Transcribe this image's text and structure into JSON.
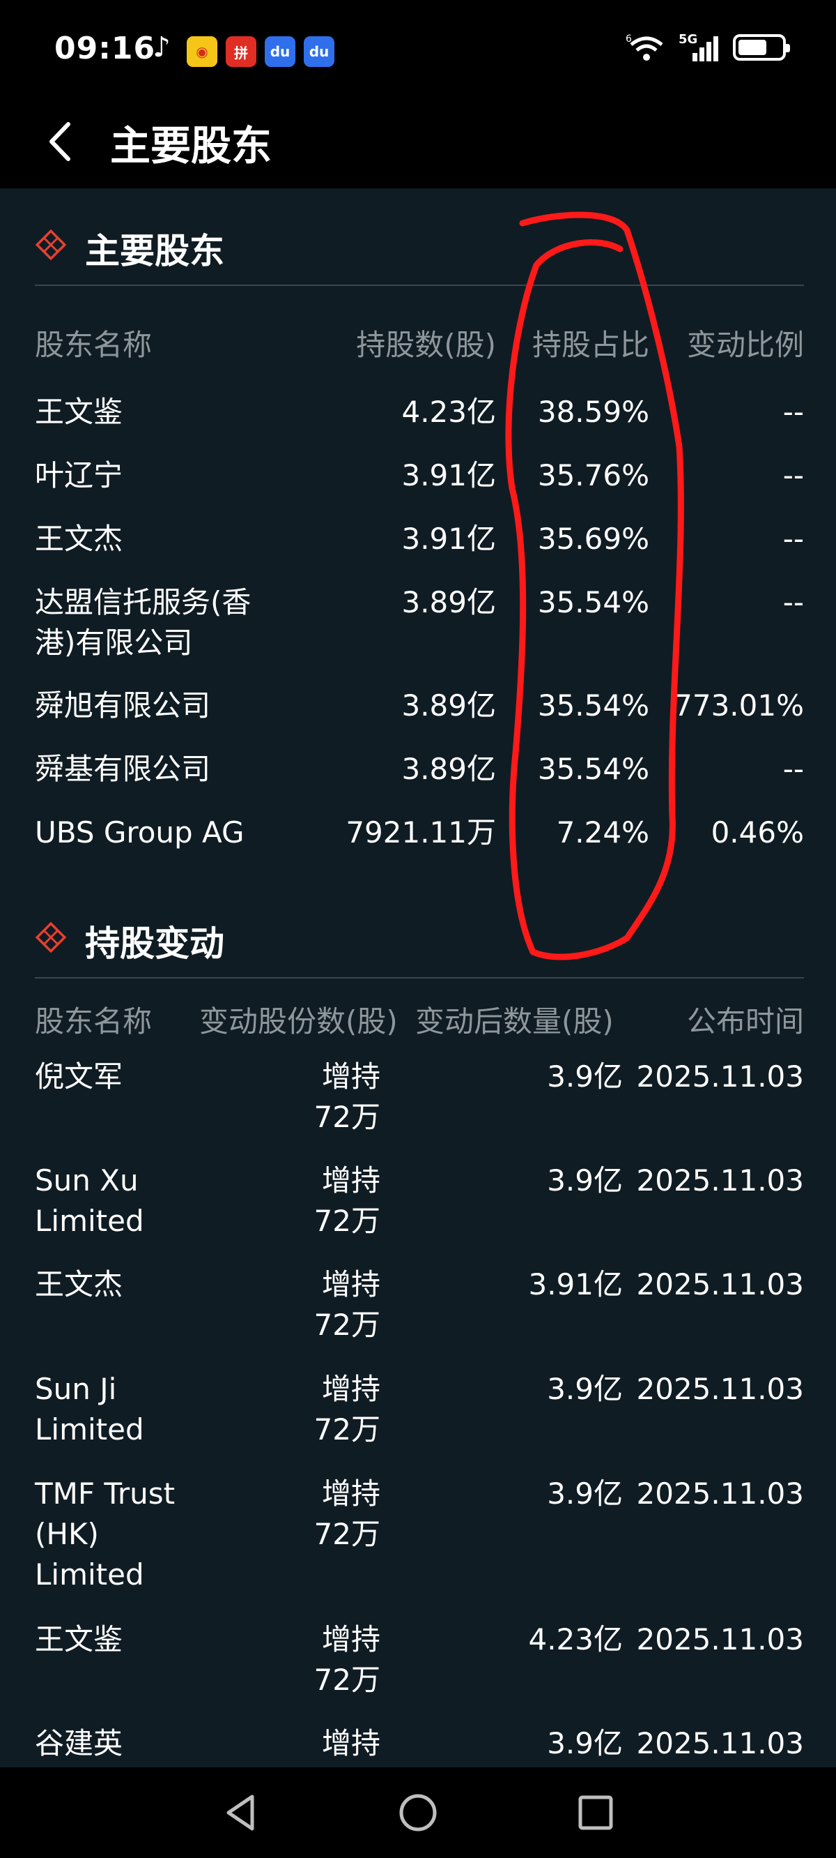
{
  "status_bar": {
    "time": "09:16",
    "network": "5G",
    "wifi_label": "6"
  },
  "header": {
    "title": "主要股东"
  },
  "holders_section": {
    "title": "主要股东",
    "columns": [
      "股东名称",
      "持股数(股)",
      "持股占比",
      "变动比例"
    ],
    "rows": [
      {
        "name": "王文鉴",
        "shares": "4.23亿",
        "pct": "38.59%",
        "change": "--"
      },
      {
        "name": "叶辽宁",
        "shares": "3.91亿",
        "pct": "35.76%",
        "change": "--"
      },
      {
        "name": "王文杰",
        "shares": "3.91亿",
        "pct": "35.69%",
        "change": "--"
      },
      {
        "name": "达盟信托服务(香港)有限公司",
        "name_line1": "达盟信托服务(香",
        "name_line2": "港)有限公司",
        "shares": "3.89亿",
        "pct": "35.54%",
        "change": "--"
      },
      {
        "name": "舜旭有限公司",
        "shares": "3.89亿",
        "pct": "35.54%",
        "change": "773.01%"
      },
      {
        "name": "舜基有限公司",
        "shares": "3.89亿",
        "pct": "35.54%",
        "change": "--"
      },
      {
        "name": "UBS Group AG",
        "shares": "7921.11万",
        "pct": "7.24%",
        "change": "0.46%"
      }
    ]
  },
  "changes_section": {
    "title": "持股变动",
    "columns": [
      "股东名称",
      "变动股份数(股)",
      "变动后数量(股)",
      "公布时间"
    ],
    "rows": [
      {
        "name_lines": [
          "倪文军"
        ],
        "delta_lines": [
          "增持",
          "72万"
        ],
        "after": "3.9亿",
        "date": "2025.11.03"
      },
      {
        "name_lines": [
          "Sun Xu",
          "Limited"
        ],
        "delta_lines": [
          "增持",
          "72万"
        ],
        "after": "3.9亿",
        "date": "2025.11.03"
      },
      {
        "name_lines": [
          "王文杰"
        ],
        "delta_lines": [
          "增持",
          "72万"
        ],
        "after": "3.91亿",
        "date": "2025.11.03"
      },
      {
        "name_lines": [
          "Sun Ji",
          "Limited"
        ],
        "delta_lines": [
          "增持",
          "72万"
        ],
        "after": "3.9亿",
        "date": "2025.11.03"
      },
      {
        "name_lines": [
          "TMF Trust",
          "(HK)",
          "Limited"
        ],
        "delta_lines": [
          "增持",
          "72万"
        ],
        "after": "3.9亿",
        "date": "2025.11.03"
      },
      {
        "name_lines": [
          "王文鉴"
        ],
        "delta_lines": [
          "增持",
          "72万"
        ],
        "after": "4.23亿",
        "date": "2025.11.03"
      },
      {
        "name_lines": [
          "谷建英"
        ],
        "delta_lines": [
          "增持"
        ],
        "after": "3.9亿",
        "date": "2025.11.03"
      }
    ]
  },
  "colors": {
    "accent": "#e8402f",
    "background": "#101c23",
    "muted": "#8e979c",
    "annotation": "#ff1a1a"
  }
}
